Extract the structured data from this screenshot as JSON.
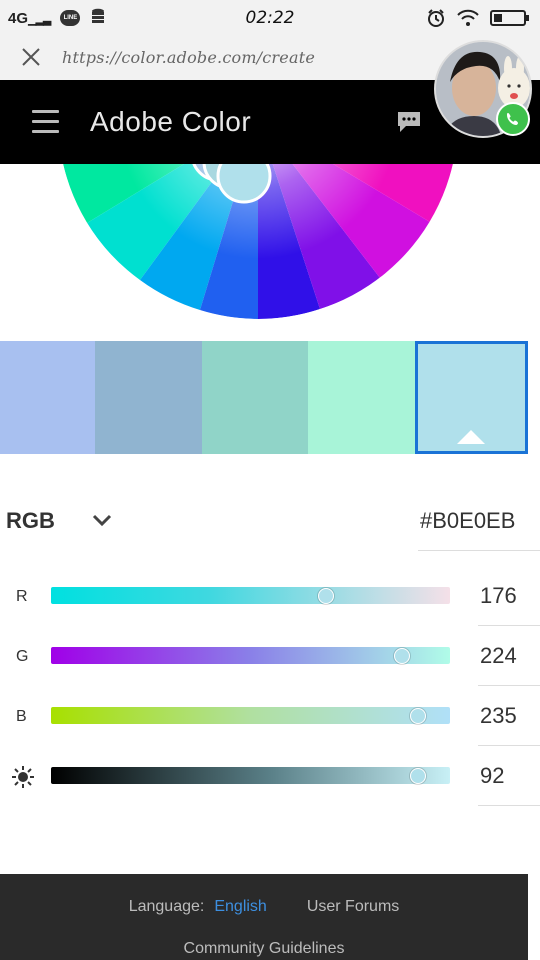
{
  "status_bar": {
    "network": "4G",
    "line_label": "LINE",
    "time": "02:22"
  },
  "browser": {
    "url": "https://color.adobe.com/create"
  },
  "header": {
    "title": "Adobe Color"
  },
  "swatches": [
    {
      "color": "#A8C0F0"
    },
    {
      "color": "#90B4D0"
    },
    {
      "color": "#90D4C8"
    },
    {
      "color": "#A8F4D8"
    },
    {
      "color": "#B0E0EB",
      "selected": true
    }
  ],
  "color_mode": {
    "label": "RGB",
    "hex": "#B0E0EB"
  },
  "sliders": [
    {
      "label": "R",
      "value": "176",
      "fraction": 0.69
    },
    {
      "label": "G",
      "value": "224",
      "fraction": 0.88
    },
    {
      "label": "B",
      "value": "235",
      "fraction": 0.92
    },
    {
      "label": "",
      "icon": "brightness-icon",
      "value": "92",
      "fraction": 0.92
    }
  ],
  "footer": {
    "language_label": "Language:",
    "language_value": "English",
    "user_forums": "User Forums",
    "community_guidelines": "Community Guidelines"
  }
}
